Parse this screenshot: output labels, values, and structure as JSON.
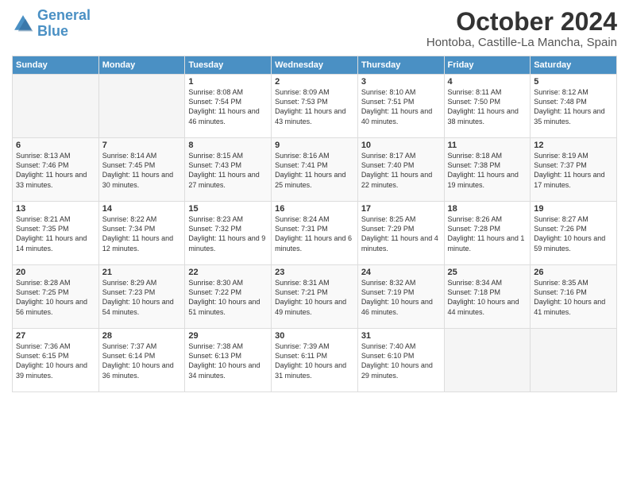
{
  "logo": {
    "line1": "General",
    "line2": "Blue"
  },
  "title": "October 2024",
  "subtitle": "Hontoba, Castille-La Mancha, Spain",
  "days_of_week": [
    "Sunday",
    "Monday",
    "Tuesday",
    "Wednesday",
    "Thursday",
    "Friday",
    "Saturday"
  ],
  "weeks": [
    [
      {
        "day": "",
        "info": ""
      },
      {
        "day": "",
        "info": ""
      },
      {
        "day": "1",
        "info": "Sunrise: 8:08 AM\nSunset: 7:54 PM\nDaylight: 11 hours and 46 minutes."
      },
      {
        "day": "2",
        "info": "Sunrise: 8:09 AM\nSunset: 7:53 PM\nDaylight: 11 hours and 43 minutes."
      },
      {
        "day": "3",
        "info": "Sunrise: 8:10 AM\nSunset: 7:51 PM\nDaylight: 11 hours and 40 minutes."
      },
      {
        "day": "4",
        "info": "Sunrise: 8:11 AM\nSunset: 7:50 PM\nDaylight: 11 hours and 38 minutes."
      },
      {
        "day": "5",
        "info": "Sunrise: 8:12 AM\nSunset: 7:48 PM\nDaylight: 11 hours and 35 minutes."
      }
    ],
    [
      {
        "day": "6",
        "info": "Sunrise: 8:13 AM\nSunset: 7:46 PM\nDaylight: 11 hours and 33 minutes."
      },
      {
        "day": "7",
        "info": "Sunrise: 8:14 AM\nSunset: 7:45 PM\nDaylight: 11 hours and 30 minutes."
      },
      {
        "day": "8",
        "info": "Sunrise: 8:15 AM\nSunset: 7:43 PM\nDaylight: 11 hours and 27 minutes."
      },
      {
        "day": "9",
        "info": "Sunrise: 8:16 AM\nSunset: 7:41 PM\nDaylight: 11 hours and 25 minutes."
      },
      {
        "day": "10",
        "info": "Sunrise: 8:17 AM\nSunset: 7:40 PM\nDaylight: 11 hours and 22 minutes."
      },
      {
        "day": "11",
        "info": "Sunrise: 8:18 AM\nSunset: 7:38 PM\nDaylight: 11 hours and 19 minutes."
      },
      {
        "day": "12",
        "info": "Sunrise: 8:19 AM\nSunset: 7:37 PM\nDaylight: 11 hours and 17 minutes."
      }
    ],
    [
      {
        "day": "13",
        "info": "Sunrise: 8:21 AM\nSunset: 7:35 PM\nDaylight: 11 hours and 14 minutes."
      },
      {
        "day": "14",
        "info": "Sunrise: 8:22 AM\nSunset: 7:34 PM\nDaylight: 11 hours and 12 minutes."
      },
      {
        "day": "15",
        "info": "Sunrise: 8:23 AM\nSunset: 7:32 PM\nDaylight: 11 hours and 9 minutes."
      },
      {
        "day": "16",
        "info": "Sunrise: 8:24 AM\nSunset: 7:31 PM\nDaylight: 11 hours and 6 minutes."
      },
      {
        "day": "17",
        "info": "Sunrise: 8:25 AM\nSunset: 7:29 PM\nDaylight: 11 hours and 4 minutes."
      },
      {
        "day": "18",
        "info": "Sunrise: 8:26 AM\nSunset: 7:28 PM\nDaylight: 11 hours and 1 minute."
      },
      {
        "day": "19",
        "info": "Sunrise: 8:27 AM\nSunset: 7:26 PM\nDaylight: 10 hours and 59 minutes."
      }
    ],
    [
      {
        "day": "20",
        "info": "Sunrise: 8:28 AM\nSunset: 7:25 PM\nDaylight: 10 hours and 56 minutes."
      },
      {
        "day": "21",
        "info": "Sunrise: 8:29 AM\nSunset: 7:23 PM\nDaylight: 10 hours and 54 minutes."
      },
      {
        "day": "22",
        "info": "Sunrise: 8:30 AM\nSunset: 7:22 PM\nDaylight: 10 hours and 51 minutes."
      },
      {
        "day": "23",
        "info": "Sunrise: 8:31 AM\nSunset: 7:21 PM\nDaylight: 10 hours and 49 minutes."
      },
      {
        "day": "24",
        "info": "Sunrise: 8:32 AM\nSunset: 7:19 PM\nDaylight: 10 hours and 46 minutes."
      },
      {
        "day": "25",
        "info": "Sunrise: 8:34 AM\nSunset: 7:18 PM\nDaylight: 10 hours and 44 minutes."
      },
      {
        "day": "26",
        "info": "Sunrise: 8:35 AM\nSunset: 7:16 PM\nDaylight: 10 hours and 41 minutes."
      }
    ],
    [
      {
        "day": "27",
        "info": "Sunrise: 7:36 AM\nSunset: 6:15 PM\nDaylight: 10 hours and 39 minutes."
      },
      {
        "day": "28",
        "info": "Sunrise: 7:37 AM\nSunset: 6:14 PM\nDaylight: 10 hours and 36 minutes."
      },
      {
        "day": "29",
        "info": "Sunrise: 7:38 AM\nSunset: 6:13 PM\nDaylight: 10 hours and 34 minutes."
      },
      {
        "day": "30",
        "info": "Sunrise: 7:39 AM\nSunset: 6:11 PM\nDaylight: 10 hours and 31 minutes."
      },
      {
        "day": "31",
        "info": "Sunrise: 7:40 AM\nSunset: 6:10 PM\nDaylight: 10 hours and 29 minutes."
      },
      {
        "day": "",
        "info": ""
      },
      {
        "day": "",
        "info": ""
      }
    ]
  ]
}
